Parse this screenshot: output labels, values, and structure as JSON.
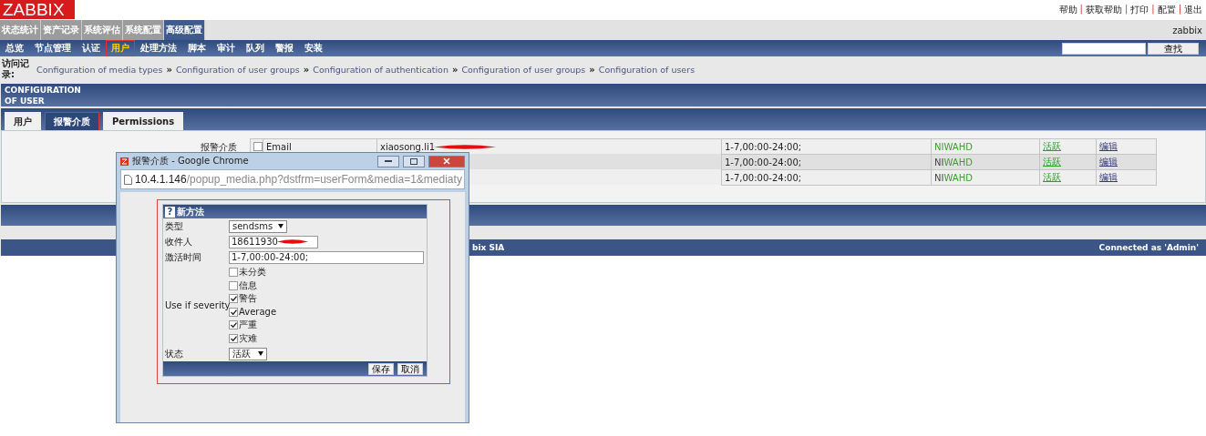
{
  "header": {
    "logo": "ZABBIX",
    "links": [
      "帮助",
      "获取帮助",
      "打印",
      "配置",
      "退出"
    ],
    "separator": "|"
  },
  "top_tabs": [
    {
      "label": "状态统计",
      "selected": false
    },
    {
      "label": "资产记录",
      "selected": false
    },
    {
      "label": "系统评估",
      "selected": false
    },
    {
      "label": "系统配置",
      "selected": false
    },
    {
      "label": "高级配置",
      "selected": true
    }
  ],
  "username": "zabbix",
  "menu": [
    {
      "label": "总览",
      "selected": false,
      "highlight": false
    },
    {
      "label": "节点管理",
      "selected": false,
      "highlight": false
    },
    {
      "label": "认证",
      "selected": false,
      "highlight": false
    },
    {
      "label": "用户",
      "selected": true,
      "highlight": true
    },
    {
      "label": "处理方法",
      "selected": false,
      "highlight": false
    },
    {
      "label": "脚本",
      "selected": false,
      "highlight": false
    },
    {
      "label": "审计",
      "selected": false,
      "highlight": false
    },
    {
      "label": "队列",
      "selected": false,
      "highlight": false
    },
    {
      "label": "警报",
      "selected": false,
      "highlight": false
    },
    {
      "label": "安装",
      "selected": false,
      "highlight": false
    }
  ],
  "search": {
    "button": "查找"
  },
  "breadcrumb": {
    "label": "访问记录:",
    "separator": "»",
    "items": [
      "Configuration of media types",
      "Configuration of user groups",
      "Configuration of authentication",
      "Configuration of user groups",
      "Configuration of users"
    ]
  },
  "section_title": "CONFIGURATION OF USER",
  "tabs": [
    {
      "label": "用户",
      "selected": false,
      "highlight": false
    },
    {
      "label": "报警介质",
      "selected": true,
      "highlight": true
    },
    {
      "label": "Permissions",
      "selected": false,
      "highlight": false
    }
  ],
  "media": {
    "label": "报警介质",
    "rows": [
      {
        "checked": false,
        "type": "Email",
        "send_to": "xiaosong.li1",
        "redacted": true,
        "period": "1-7,00:00-24:00;",
        "severity": [
          {
            "letter": "N",
            "active": true
          },
          {
            "letter": "I",
            "active": true
          },
          {
            "letter": "W",
            "active": true
          },
          {
            "letter": "A",
            "active": true
          },
          {
            "letter": "H",
            "active": true
          },
          {
            "letter": "D",
            "active": true
          }
        ],
        "status": "活跃",
        "action": "编辑"
      },
      {
        "period": "1-7,00:00-24:00;",
        "severity": [
          {
            "letter": "N",
            "active": false
          },
          {
            "letter": "I",
            "active": false
          },
          {
            "letter": "W",
            "active": true
          },
          {
            "letter": "A",
            "active": true
          },
          {
            "letter": "H",
            "active": true
          },
          {
            "letter": "D",
            "active": true
          }
        ],
        "status": "活跃",
        "action": "编辑"
      },
      {
        "period": "1-7,00:00-24:00;",
        "severity": [
          {
            "letter": "N",
            "active": false
          },
          {
            "letter": "I",
            "active": false
          },
          {
            "letter": "W",
            "active": true
          },
          {
            "letter": "A",
            "active": true
          },
          {
            "letter": "H",
            "active": true
          },
          {
            "letter": "D",
            "active": true
          }
        ],
        "status": "活跃",
        "action": "编辑"
      }
    ]
  },
  "footer": {
    "copyright": "bix SIA",
    "connected": "Connected as 'Admin'"
  },
  "popup": {
    "title": "报警介质 - Google Chrome",
    "url_host": "10.4.1.146",
    "url_path": "/popup_media.php?dstfrm=userForm&media=1&mediaty",
    "frame_highlight": true,
    "form": {
      "help": "?",
      "title": "新方法",
      "rows": [
        {
          "kind": "select",
          "label": "类型",
          "value": "sendsms"
        },
        {
          "kind": "input",
          "label": "收件人",
          "value": "18611930",
          "redacted": true
        },
        {
          "kind": "input",
          "label": "激活时间",
          "value": "1-7,00:00-24:00;"
        },
        {
          "kind": "checkboxes",
          "label": "Use if severity",
          "options": [
            {
              "label": "未分类",
              "checked": false
            },
            {
              "label": "信息",
              "checked": false
            },
            {
              "label": "警告",
              "checked": true
            },
            {
              "label": "Average",
              "checked": true
            },
            {
              "label": "严重",
              "checked": true
            },
            {
              "label": "灾难",
              "checked": true
            }
          ]
        },
        {
          "kind": "select",
          "label": "状态",
          "value": "活跃"
        }
      ],
      "buttons": [
        "保存",
        "取消"
      ]
    }
  }
}
